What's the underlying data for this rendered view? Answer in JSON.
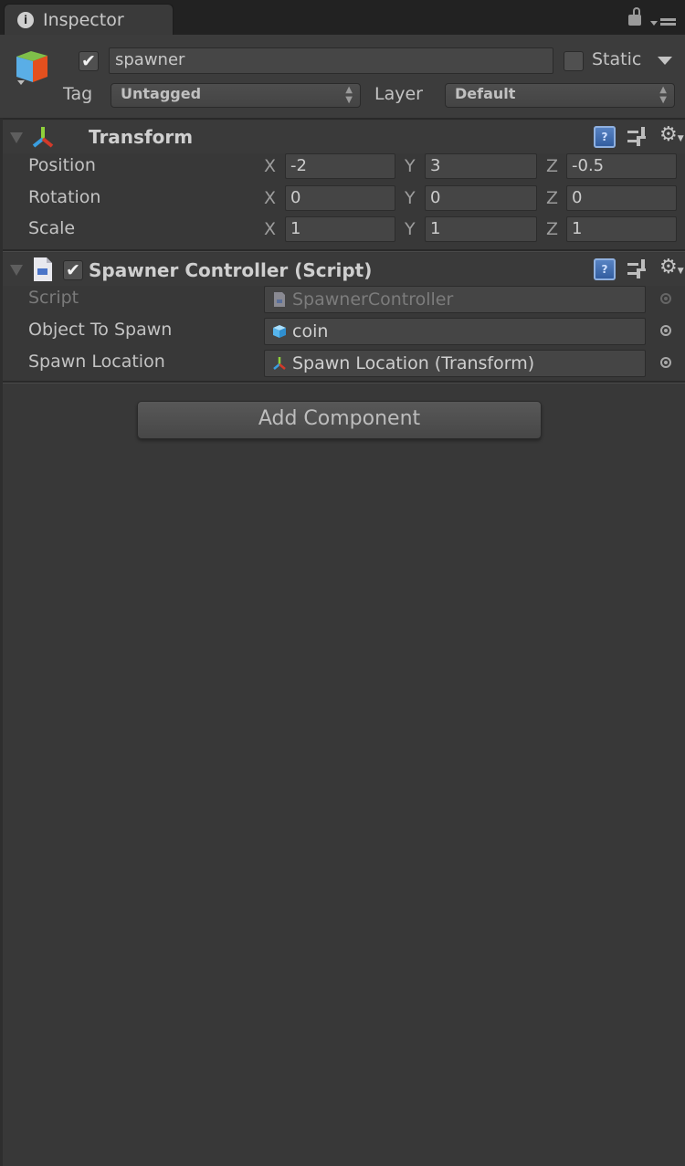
{
  "window": {
    "tab_label": "Inspector",
    "tab_icon": "info-icon",
    "lock_icon": "lock-icon",
    "menu_icon": "panel-menu-icon"
  },
  "gameobject": {
    "icon": "gameobject-cube-icon",
    "active": true,
    "name": "spawner",
    "static_label": "Static",
    "static_checked": false,
    "tag_label": "Tag",
    "tag_value": "Untagged",
    "layer_label": "Layer",
    "layer_value": "Default"
  },
  "components": [
    {
      "title": "Transform",
      "icon": "transform-axes-icon",
      "expanded": true,
      "rows": [
        {
          "label": "Position",
          "x": "-2",
          "y": "3",
          "z": "-0.5"
        },
        {
          "label": "Rotation",
          "x": "0",
          "y": "0",
          "z": "0"
        },
        {
          "label": "Scale",
          "x": "1",
          "y": "1",
          "z": "1"
        }
      ],
      "axis_labels": {
        "x": "X",
        "y": "Y",
        "z": "Z"
      }
    },
    {
      "title": "Spawner Controller (Script)",
      "icon": "csharp-script-icon",
      "enabled": true,
      "expanded": true,
      "fields": [
        {
          "label": "Script",
          "value": "SpawnerController",
          "icon": "script-file-icon",
          "disabled": true
        },
        {
          "label": "Object To Spawn",
          "value": "coin",
          "icon": "prefab-cube-icon",
          "disabled": false
        },
        {
          "label": "Spawn Location",
          "value": "Spawn Location (Transform)",
          "icon": "transform-axes-icon",
          "disabled": false
        }
      ]
    }
  ],
  "header_icons": {
    "help": "help-book-icon",
    "preset": "preset-sliders-icon",
    "settings": "gear-icon"
  },
  "add_component_label": "Add Component",
  "colors": {
    "background": "#383838",
    "tabbar": "#222222",
    "help_icon": "#3f6db0",
    "axis_x": "#d23a2a",
    "axis_y": "#8fd13a",
    "axis_z": "#3a9ee0"
  }
}
